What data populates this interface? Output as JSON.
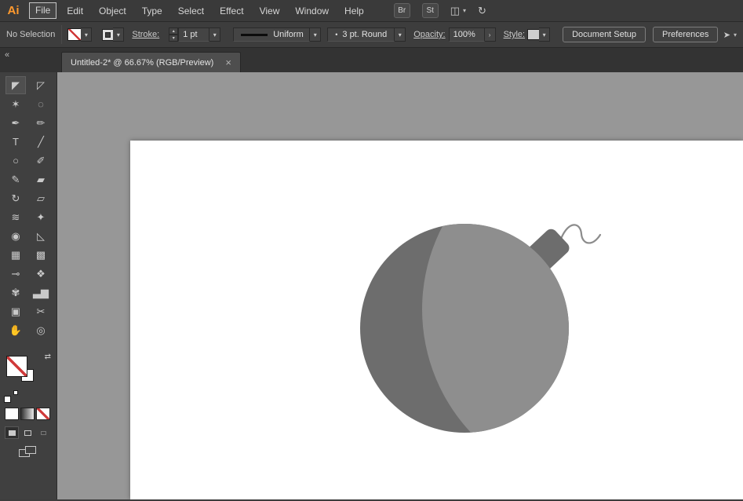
{
  "app": {
    "logo": "Ai"
  },
  "menubar": {
    "items": [
      {
        "name": "menu-file",
        "label": "File",
        "boxed": true
      },
      {
        "name": "menu-edit",
        "label": "Edit"
      },
      {
        "name": "menu-object",
        "label": "Object"
      },
      {
        "name": "menu-type",
        "label": "Type"
      },
      {
        "name": "menu-select",
        "label": "Select"
      },
      {
        "name": "menu-effect",
        "label": "Effect"
      },
      {
        "name": "menu-view",
        "label": "View"
      },
      {
        "name": "menu-window",
        "label": "Window"
      },
      {
        "name": "menu-help",
        "label": "Help"
      }
    ],
    "bridge_label": "Br",
    "stock_label": "St"
  },
  "controlbar": {
    "selection_status": "No Selection",
    "stroke_label": "Stroke:",
    "stroke_weight": "1 pt",
    "width_profile": "Uniform",
    "brush_bullet": "•",
    "brush_name": "3 pt. Round",
    "opacity_label": "Opacity:",
    "opacity_value": "100%",
    "style_label": "Style:",
    "document_setup_label": "Document Setup",
    "preferences_label": "Preferences"
  },
  "tabbar": {
    "collapse_glyph": "«",
    "tab_title": "Untitled-2* @ 66.67% (RGB/Preview)",
    "close_glyph": "×"
  },
  "toolbar": {
    "tools": [
      {
        "name": "selection-tool",
        "glyph": "◤",
        "selected": true
      },
      {
        "name": "direct-selection-tool",
        "glyph": "◸"
      },
      {
        "name": "magic-wand-tool",
        "glyph": "✶"
      },
      {
        "name": "lasso-tool",
        "glyph": "◌"
      },
      {
        "name": "pen-tool",
        "glyph": "✒"
      },
      {
        "name": "curvature-tool",
        "glyph": "✏"
      },
      {
        "name": "type-tool",
        "glyph": "T"
      },
      {
        "name": "line-segment-tool",
        "glyph": "╱"
      },
      {
        "name": "ellipse-tool",
        "glyph": "○"
      },
      {
        "name": "paintbrush-tool",
        "glyph": "✐"
      },
      {
        "name": "pencil-tool",
        "glyph": "✎"
      },
      {
        "name": "eraser-tool",
        "glyph": "▰"
      },
      {
        "name": "rotate-tool",
        "glyph": "↻"
      },
      {
        "name": "scale-tool",
        "glyph": "▱"
      },
      {
        "name": "width-tool",
        "glyph": "≋"
      },
      {
        "name": "free-transform-tool",
        "glyph": "✦"
      },
      {
        "name": "shape-builder-tool",
        "glyph": "◉"
      },
      {
        "name": "perspective-grid-tool",
        "glyph": "◺"
      },
      {
        "name": "mesh-tool",
        "glyph": "▦"
      },
      {
        "name": "gradient-tool",
        "glyph": "▩"
      },
      {
        "name": "eyedropper-tool",
        "glyph": "⊸"
      },
      {
        "name": "blend-tool",
        "glyph": "❖"
      },
      {
        "name": "symbol-sprayer-tool",
        "glyph": "✾"
      },
      {
        "name": "column-graph-tool",
        "glyph": "▃▆"
      },
      {
        "name": "artboard-tool",
        "glyph": "▣"
      },
      {
        "name": "slice-tool",
        "glyph": "✂"
      },
      {
        "name": "hand-tool",
        "glyph": "✋"
      },
      {
        "name": "zoom-tool",
        "glyph": "◎"
      }
    ]
  },
  "icons": {
    "dropdown": "▾",
    "step_up": "▴",
    "step_down": "▾",
    "opacity_arrow": "›",
    "arrange_documents": "◫",
    "sync": "↻",
    "swap_fill_stroke": "⇄",
    "workspace": "➤"
  },
  "artwork": {
    "body_color": "#6d6d6d",
    "highlight_color": "#8e8e8e",
    "cap_color": "#6d6d6d",
    "fuse_color": "#8c8c8c"
  },
  "colors": {
    "chrome": "#3d3d3d",
    "pasteboard": "#979797",
    "artboard": "#ffffff",
    "logo_accent": "#ff9a2e",
    "none_slash": "#d03a3a"
  }
}
